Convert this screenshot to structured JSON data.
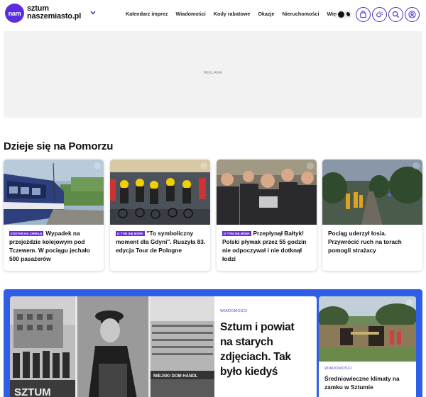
{
  "header": {
    "logo_badge": "nam",
    "logo_line1": "sztum",
    "logo_line2": "naszemiasto.pl",
    "nav": [
      "Kalendarz imprez",
      "Wiadomości",
      "Kody rabatowe",
      "Okazje",
      "Nieruchomości",
      "Więcej"
    ]
  },
  "ad": {
    "label": "REKLAMA"
  },
  "section": {
    "title": "Dzieje się na Pomorzu"
  },
  "cards": [
    {
      "badge": "ZOSTAŃ NA CHWILĘ",
      "title": "Wypadek na przejeździe kolejowym pod Tczewem. W pociągu jechało 500 pasażerów"
    },
    {
      "badge": "O TYM SIĘ MÓWI",
      "title": "\"To symboliczny moment dla Gdyni\". Ruszyła 83. edycja Tour de Pologne"
    },
    {
      "badge": "O TYM SIĘ MÓWI",
      "title": "Przepłynął Bałtyk! Polski pływak przez 55 godzin nie odpoczywał i nie dotknął łodzi"
    },
    {
      "badge": "",
      "title": "Pociąg uderzył łosia. Przywrócić ruch na torach pomogli strażacy"
    }
  ],
  "feature": {
    "tag": "WIADOMOŚCI",
    "title": "Sztum i powiat na starych zdjęciach. Tak było kiedyś",
    "photo_sign": "SZTUM",
    "photo_shop_sign": "MIEJSKI DOM HANDL"
  },
  "side": {
    "tag": "WIADOMOŚCI",
    "title": "Średniowieczne klimaty na zamku w Sztumie"
  },
  "colors": {
    "brand": "#5b2de0",
    "badge": "#6a2bd8",
    "feature_bg": "#2f5ee6",
    "tag": "#4a55c8"
  }
}
